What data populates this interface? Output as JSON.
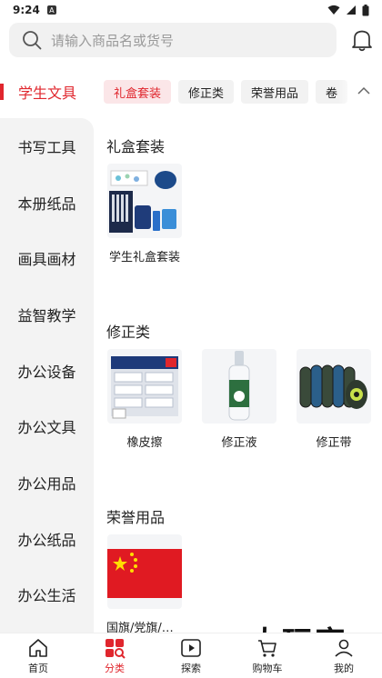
{
  "status_bar": {
    "time": "9:24",
    "badge": "A"
  },
  "search": {
    "placeholder": "请输入商品名或货号"
  },
  "top_category": {
    "active": "学生文具",
    "chips": [
      {
        "label": "礼盒套装",
        "selected": true
      },
      {
        "label": "修正类",
        "selected": false
      },
      {
        "label": "荣誉用品",
        "selected": false
      },
      {
        "label": "卷",
        "selected": false
      }
    ]
  },
  "sidebar": {
    "items": [
      "书写工具",
      "本册纸品",
      "画具画材",
      "益智教学",
      "办公设备",
      "办公文具",
      "办公用品",
      "办公纸品",
      "办公生活"
    ]
  },
  "sections": [
    {
      "title": "礼盒套装",
      "products": [
        {
          "name": "学生礼盒套装",
          "image": "gift-set"
        }
      ]
    },
    {
      "title": "修正类",
      "products": [
        {
          "name": "橡皮擦",
          "image": "eraser"
        },
        {
          "name": "修正液",
          "image": "correction-fluid"
        },
        {
          "name": "修正带",
          "image": "correction-tape"
        }
      ]
    },
    {
      "title": "荣誉用品",
      "products": [
        {
          "name": "国旗/党旗/红...",
          "image": "china-flag"
        }
      ]
    }
  ],
  "watermark": "大玩客",
  "bottom_nav": [
    {
      "label": "首页",
      "icon": "home-icon",
      "active": false
    },
    {
      "label": "分类",
      "icon": "category-icon",
      "active": true
    },
    {
      "label": "探索",
      "icon": "explore-icon",
      "active": false
    },
    {
      "label": "购物车",
      "icon": "cart-icon",
      "active": false
    },
    {
      "label": "我的",
      "icon": "profile-icon",
      "active": false
    }
  ],
  "colors": {
    "accent": "#e0262d",
    "chip_bg": "#f2f2f2",
    "chip_selected_bg": "#fbe6e8",
    "sidebar_bg": "#f3f3f3"
  }
}
